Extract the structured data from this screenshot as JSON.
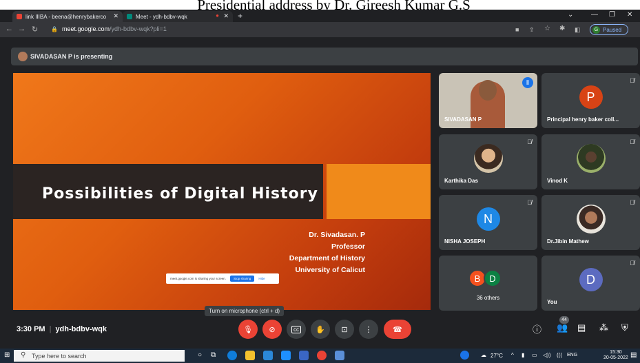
{
  "caption": "Presidential address by Dr. Gireesh Kumar G.S",
  "browser": {
    "tabs": [
      {
        "label": "link IIIBA - beena@henrybakerco",
        "active": true
      },
      {
        "label": "Meet - ydh-bdbv-wqk",
        "active": false
      }
    ],
    "new_tab": "+",
    "url_host": "meet.google.com",
    "url_path": "/ydh-bdbv-wqk?pli=1",
    "profile_letter": "G",
    "profile_status": "Paused"
  },
  "meet": {
    "presenting_banner": "SIVADASAN P is presenting",
    "slide": {
      "title": "Possibilities of Digital History",
      "author": "Dr. Sivadasan. P",
      "position": "Professor",
      "department": "Department of History",
      "university": "University of Calicut",
      "share_notice": "meet.google.com is sharing your screen.",
      "stop_sharing": "Stop sharing",
      "hide": "Hide"
    },
    "participants": [
      {
        "name": "SIVADASAN P"
      },
      {
        "name": "Principal henry baker coll...",
        "initial": "P",
        "color": "#d84315"
      },
      {
        "name": "Karthika Das"
      },
      {
        "name": "Vinod K"
      },
      {
        "name": "NISHA JOSEPH",
        "initial": "N",
        "color": "#1e88e5"
      },
      {
        "name": "Dr.Jibin Mathew"
      },
      {
        "name": "36 others",
        "initials": [
          "B",
          "D"
        ],
        "colors": [
          "#f4511e",
          "#0b8043"
        ]
      },
      {
        "name": "You",
        "initial": "D",
        "color": "#5c6bc0"
      }
    ],
    "tooltip": "Turn on microphone (ctrl + d)",
    "time": "3:30 PM",
    "meeting_code": "ydh-bdbv-wqk",
    "people_count": "44"
  },
  "taskbar": {
    "search_placeholder": "Type here to search",
    "weather": "27°C",
    "language": "ENG",
    "time": "15:30",
    "date": "20-05-2022"
  }
}
